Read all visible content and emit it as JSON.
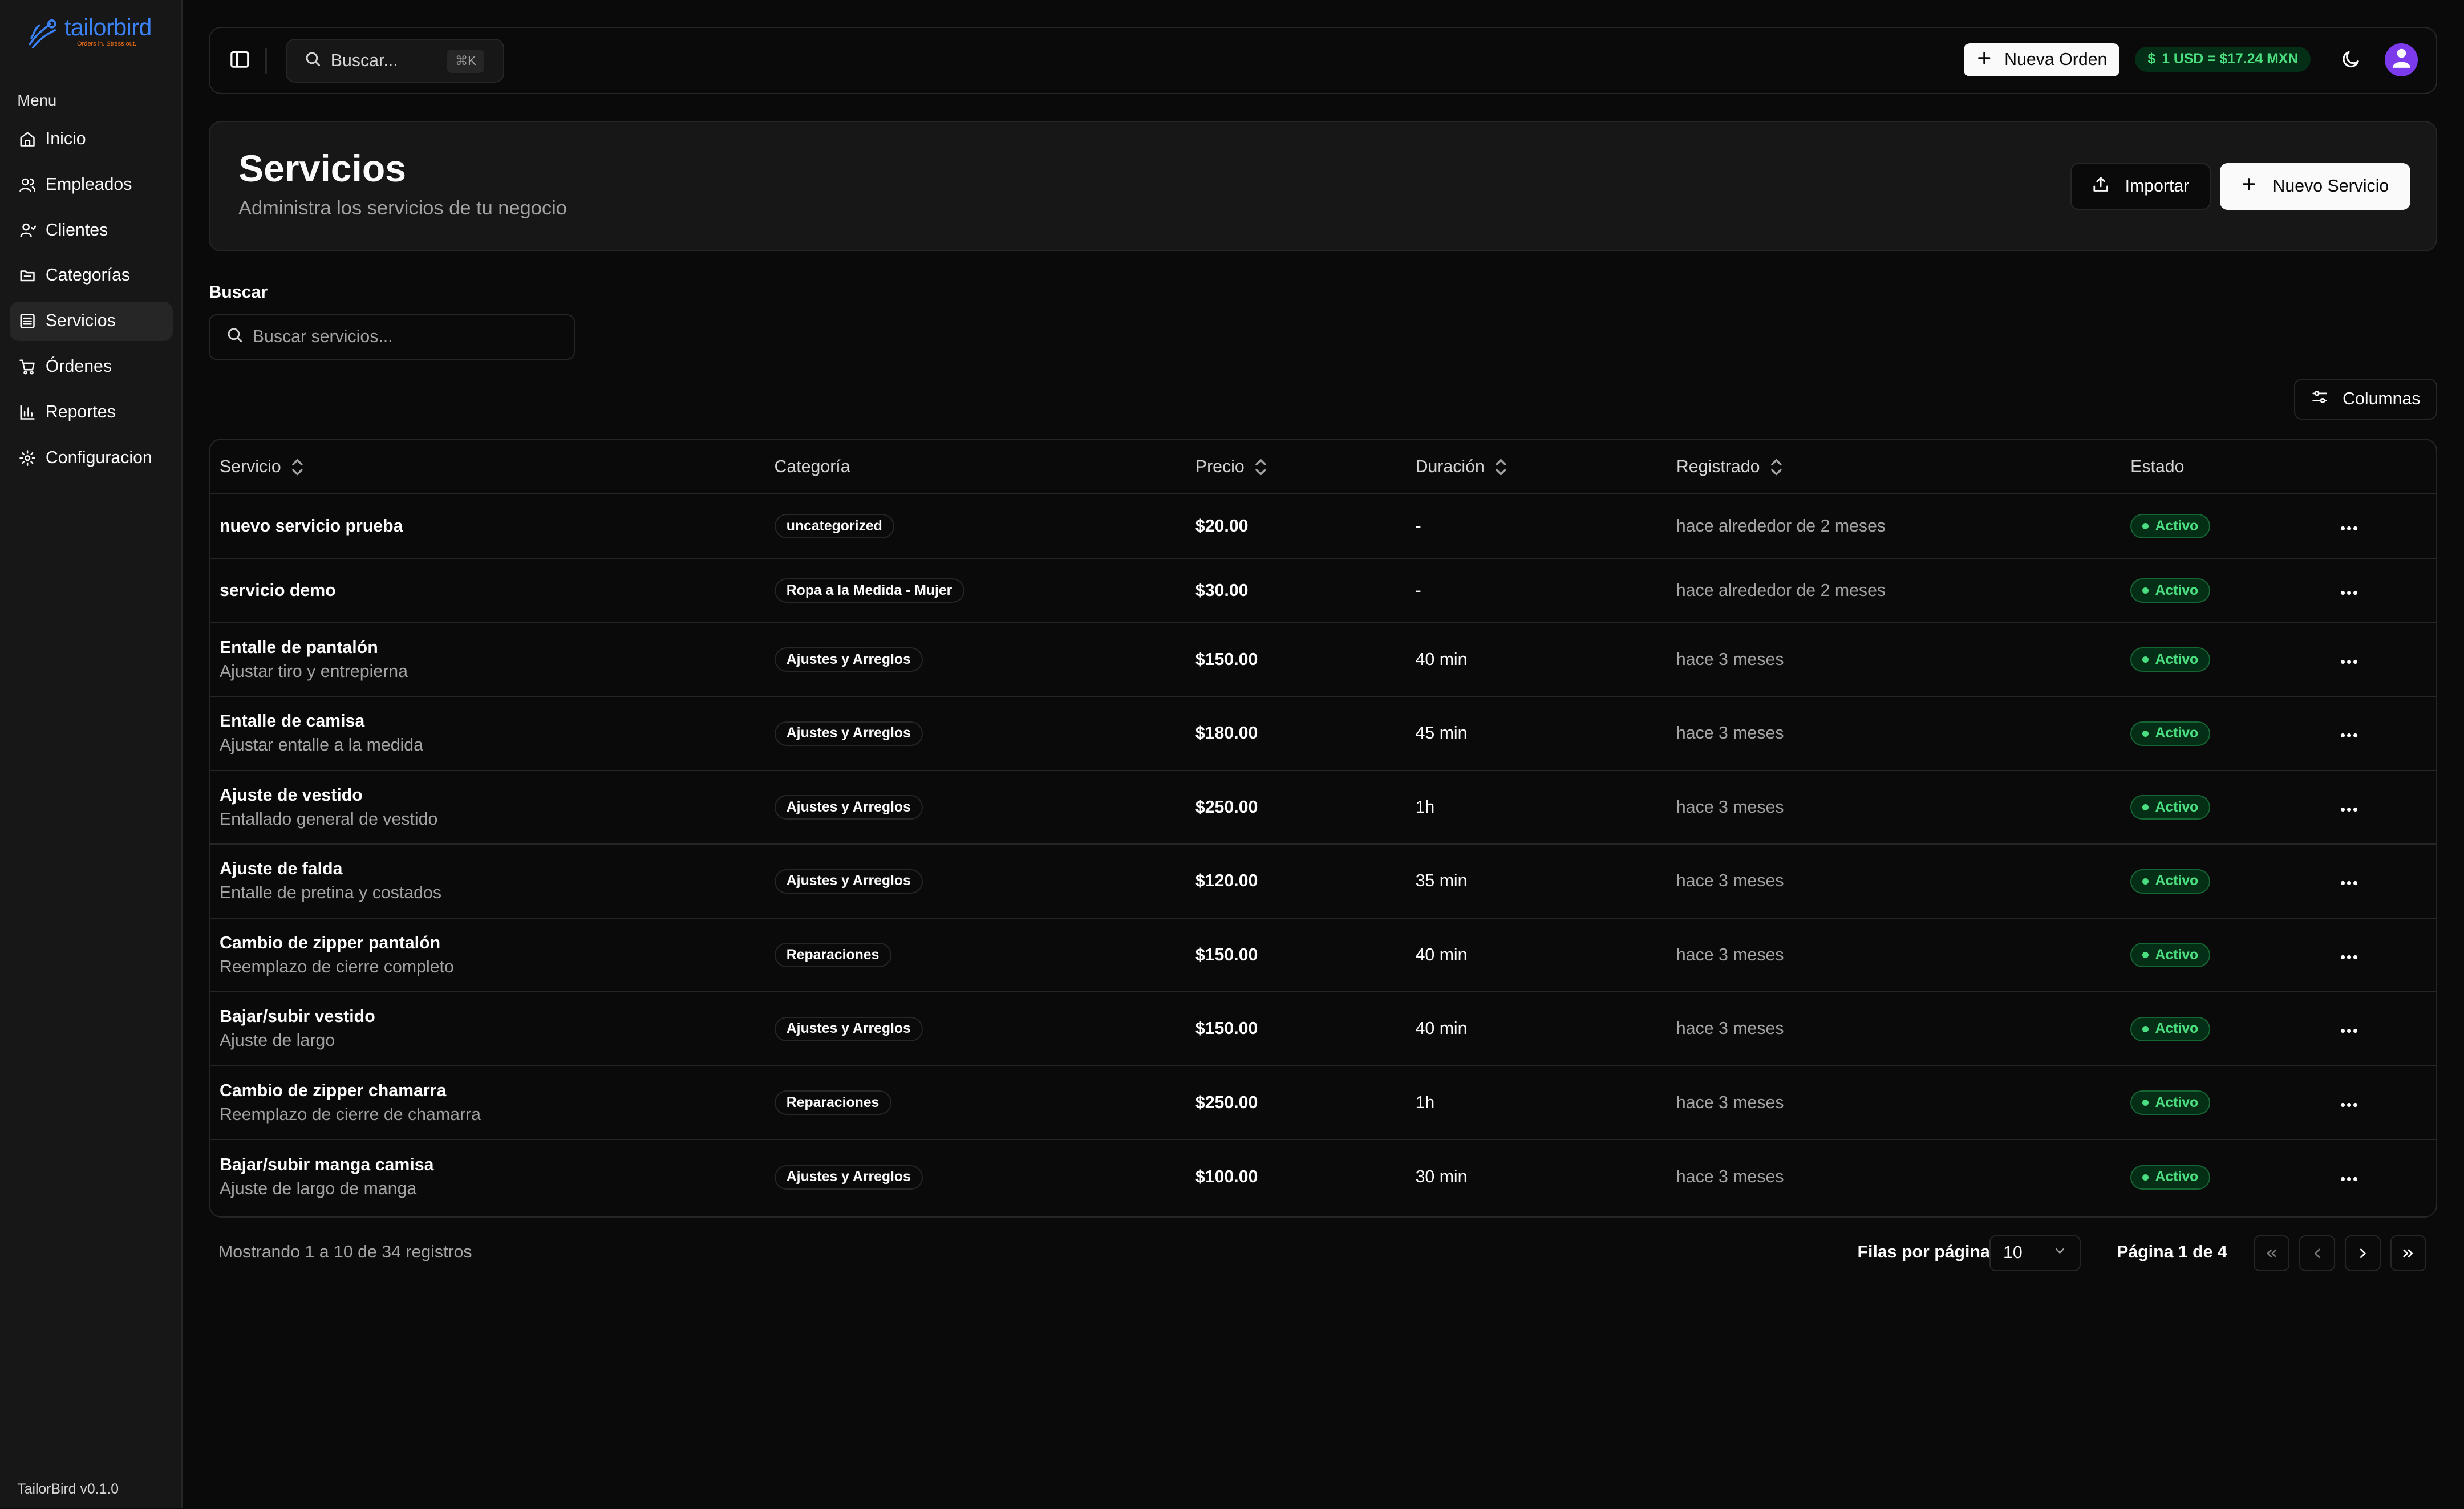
{
  "app": {
    "logo_name": "tailorbird",
    "logo_tagline": "Orders in. Stress out.",
    "version": "TailorBird v0.1.0"
  },
  "colors": {
    "accent": "#3b82f6",
    "status_green": "#4ade80",
    "avatar": "#7c3aed"
  },
  "sidebar": {
    "menu_label": "Menu",
    "items": [
      {
        "label": "Inicio",
        "icon": "home-icon",
        "active": false
      },
      {
        "label": "Empleados",
        "icon": "users-icon",
        "active": false
      },
      {
        "label": "Clientes",
        "icon": "user-icon",
        "active": false
      },
      {
        "label": "Categorías",
        "icon": "folder-icon",
        "active": false
      },
      {
        "label": "Servicios",
        "icon": "list-icon",
        "active": true
      },
      {
        "label": "Órdenes",
        "icon": "cart-icon",
        "active": false
      },
      {
        "label": "Reportes",
        "icon": "bar-chart-icon",
        "active": false
      },
      {
        "label": "Configuracion",
        "icon": "gear-icon",
        "active": false
      }
    ]
  },
  "topbar": {
    "search_placeholder": "Buscar...",
    "search_shortcut": "⌘K",
    "new_order_label": "Nueva Orden",
    "exchange_rate": "1 USD = $17.24 MXN",
    "exchange_symbol": "$"
  },
  "header": {
    "title": "Servicios",
    "subtitle": "Administra los servicios de tu negocio",
    "import_label": "Importar",
    "new_service_label": "Nuevo Servicio"
  },
  "search": {
    "label": "Buscar",
    "placeholder": "Buscar servicios..."
  },
  "columns_button": "Columnas",
  "table": {
    "headers": {
      "service": "Servicio",
      "category": "Categoría",
      "price": "Precio",
      "duration": "Duración",
      "registered": "Registrado",
      "status": "Estado"
    },
    "rows": [
      {
        "name": "nuevo servicio prueba",
        "desc": "",
        "category": "uncategorized",
        "price": "$20.00",
        "duration": "-",
        "registered": "hace alrededor de 2 meses",
        "status": "Activo"
      },
      {
        "name": "servicio demo",
        "desc": "",
        "category": "Ropa a la Medida - Mujer",
        "price": "$30.00",
        "duration": "-",
        "registered": "hace alrededor de 2 meses",
        "status": "Activo"
      },
      {
        "name": "Entalle de pantalón",
        "desc": "Ajustar tiro y entrepierna",
        "category": "Ajustes y Arreglos",
        "price": "$150.00",
        "duration": "40 min",
        "registered": "hace 3 meses",
        "status": "Activo"
      },
      {
        "name": "Entalle de camisa",
        "desc": "Ajustar entalle a la medida",
        "category": "Ajustes y Arreglos",
        "price": "$180.00",
        "duration": "45 min",
        "registered": "hace 3 meses",
        "status": "Activo"
      },
      {
        "name": "Ajuste de vestido",
        "desc": "Entallado general de vestido",
        "category": "Ajustes y Arreglos",
        "price": "$250.00",
        "duration": "1h",
        "registered": "hace 3 meses",
        "status": "Activo"
      },
      {
        "name": "Ajuste de falda",
        "desc": "Entalle de pretina y costados",
        "category": "Ajustes y Arreglos",
        "price": "$120.00",
        "duration": "35 min",
        "registered": "hace 3 meses",
        "status": "Activo"
      },
      {
        "name": "Cambio de zipper pantalón",
        "desc": "Reemplazo de cierre completo",
        "category": "Reparaciones",
        "price": "$150.00",
        "duration": "40 min",
        "registered": "hace 3 meses",
        "status": "Activo"
      },
      {
        "name": "Bajar/subir vestido",
        "desc": "Ajuste de largo",
        "category": "Ajustes y Arreglos",
        "price": "$150.00",
        "duration": "40 min",
        "registered": "hace 3 meses",
        "status": "Activo"
      },
      {
        "name": "Cambio de zipper chamarra",
        "desc": "Reemplazo de cierre de chamarra",
        "category": "Reparaciones",
        "price": "$250.00",
        "duration": "1h",
        "registered": "hace 3 meses",
        "status": "Activo"
      },
      {
        "name": "Bajar/subir manga camisa",
        "desc": "Ajuste de largo de manga",
        "category": "Ajustes y Arreglos",
        "price": "$100.00",
        "duration": "30 min",
        "registered": "hace 3 meses",
        "status": "Activo"
      }
    ]
  },
  "pagination": {
    "summary": "Mostrando 1 a 10 de 34 registros",
    "rows_per_page_label": "Filas por página",
    "rows_per_page_value": "10",
    "page_label": "Página 1 de 4"
  }
}
